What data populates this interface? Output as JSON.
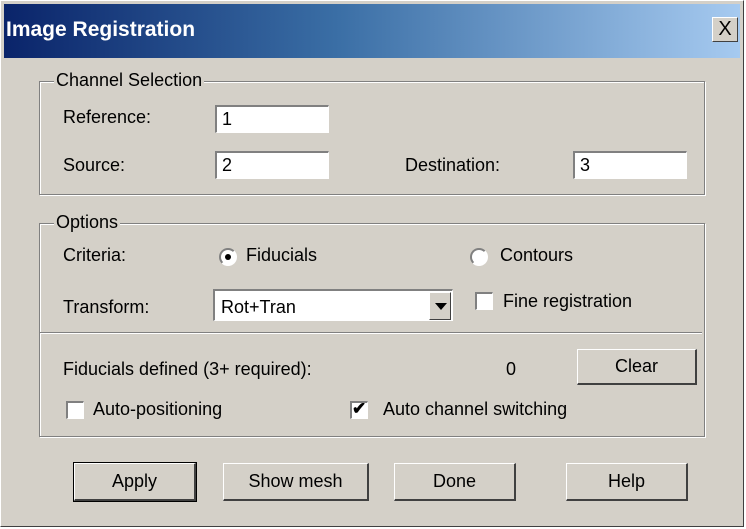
{
  "window": {
    "title": "Image Registration",
    "close_label": "X"
  },
  "channel_selection": {
    "legend": "Channel Selection",
    "reference_label": "Reference:",
    "reference_value": "1",
    "source_label": "Source:",
    "source_value": "2",
    "destination_label": "Destination:",
    "destination_value": "3"
  },
  "options": {
    "legend": "Options",
    "criteria_label": "Criteria:",
    "criteria_options": [
      "Fiducials",
      "Contours"
    ],
    "criteria_selected": "Fiducials",
    "transform_label": "Transform:",
    "transform_value": "Rot+Tran",
    "fine_registration_label": "Fine registration",
    "fine_registration_checked": false,
    "fiducials_label": "Fiducials defined (3+ required):",
    "fiducials_count": "0",
    "clear_label": "Clear",
    "auto_positioning_label": "Auto-positioning",
    "auto_positioning_checked": false,
    "auto_channel_label": "Auto channel switching",
    "auto_channel_checked": true
  },
  "buttons": {
    "apply": "Apply",
    "show_mesh": "Show mesh",
    "done": "Done",
    "help": "Help"
  }
}
